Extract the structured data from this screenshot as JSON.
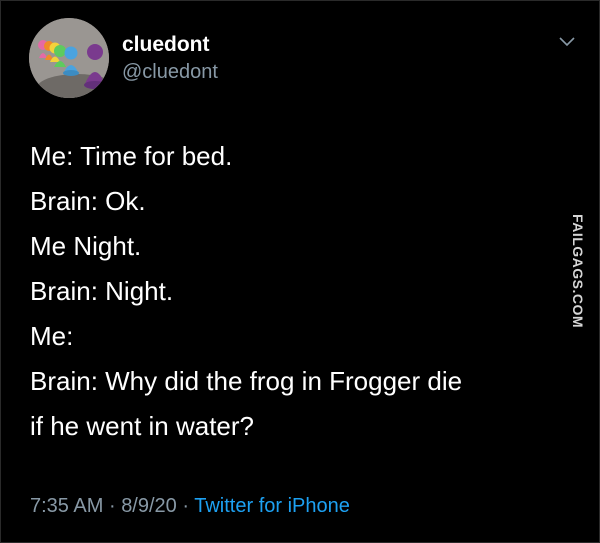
{
  "author": {
    "name": "cluedont",
    "handle": "@cluedont"
  },
  "tweet": {
    "lines": [
      "Me: Time for bed.",
      "Brain: Ok.",
      "Me Night.",
      "Brain: Night.",
      "Me:",
      "Brain: Why did the frog in Frogger die",
      "if he went in water?"
    ]
  },
  "meta": {
    "time": "7:35 AM",
    "separator": "·",
    "date": "8/9/20",
    "source": "Twitter for iPhone"
  },
  "watermark": "FAILGAGS.COM",
  "icons": {
    "avatar": "board-game-pawns-avatar",
    "chevron": "chevron-down-icon"
  },
  "colors": {
    "background": "#000000",
    "text": "#ffffff",
    "muted": "#8899a6",
    "link": "#1da1f2"
  }
}
